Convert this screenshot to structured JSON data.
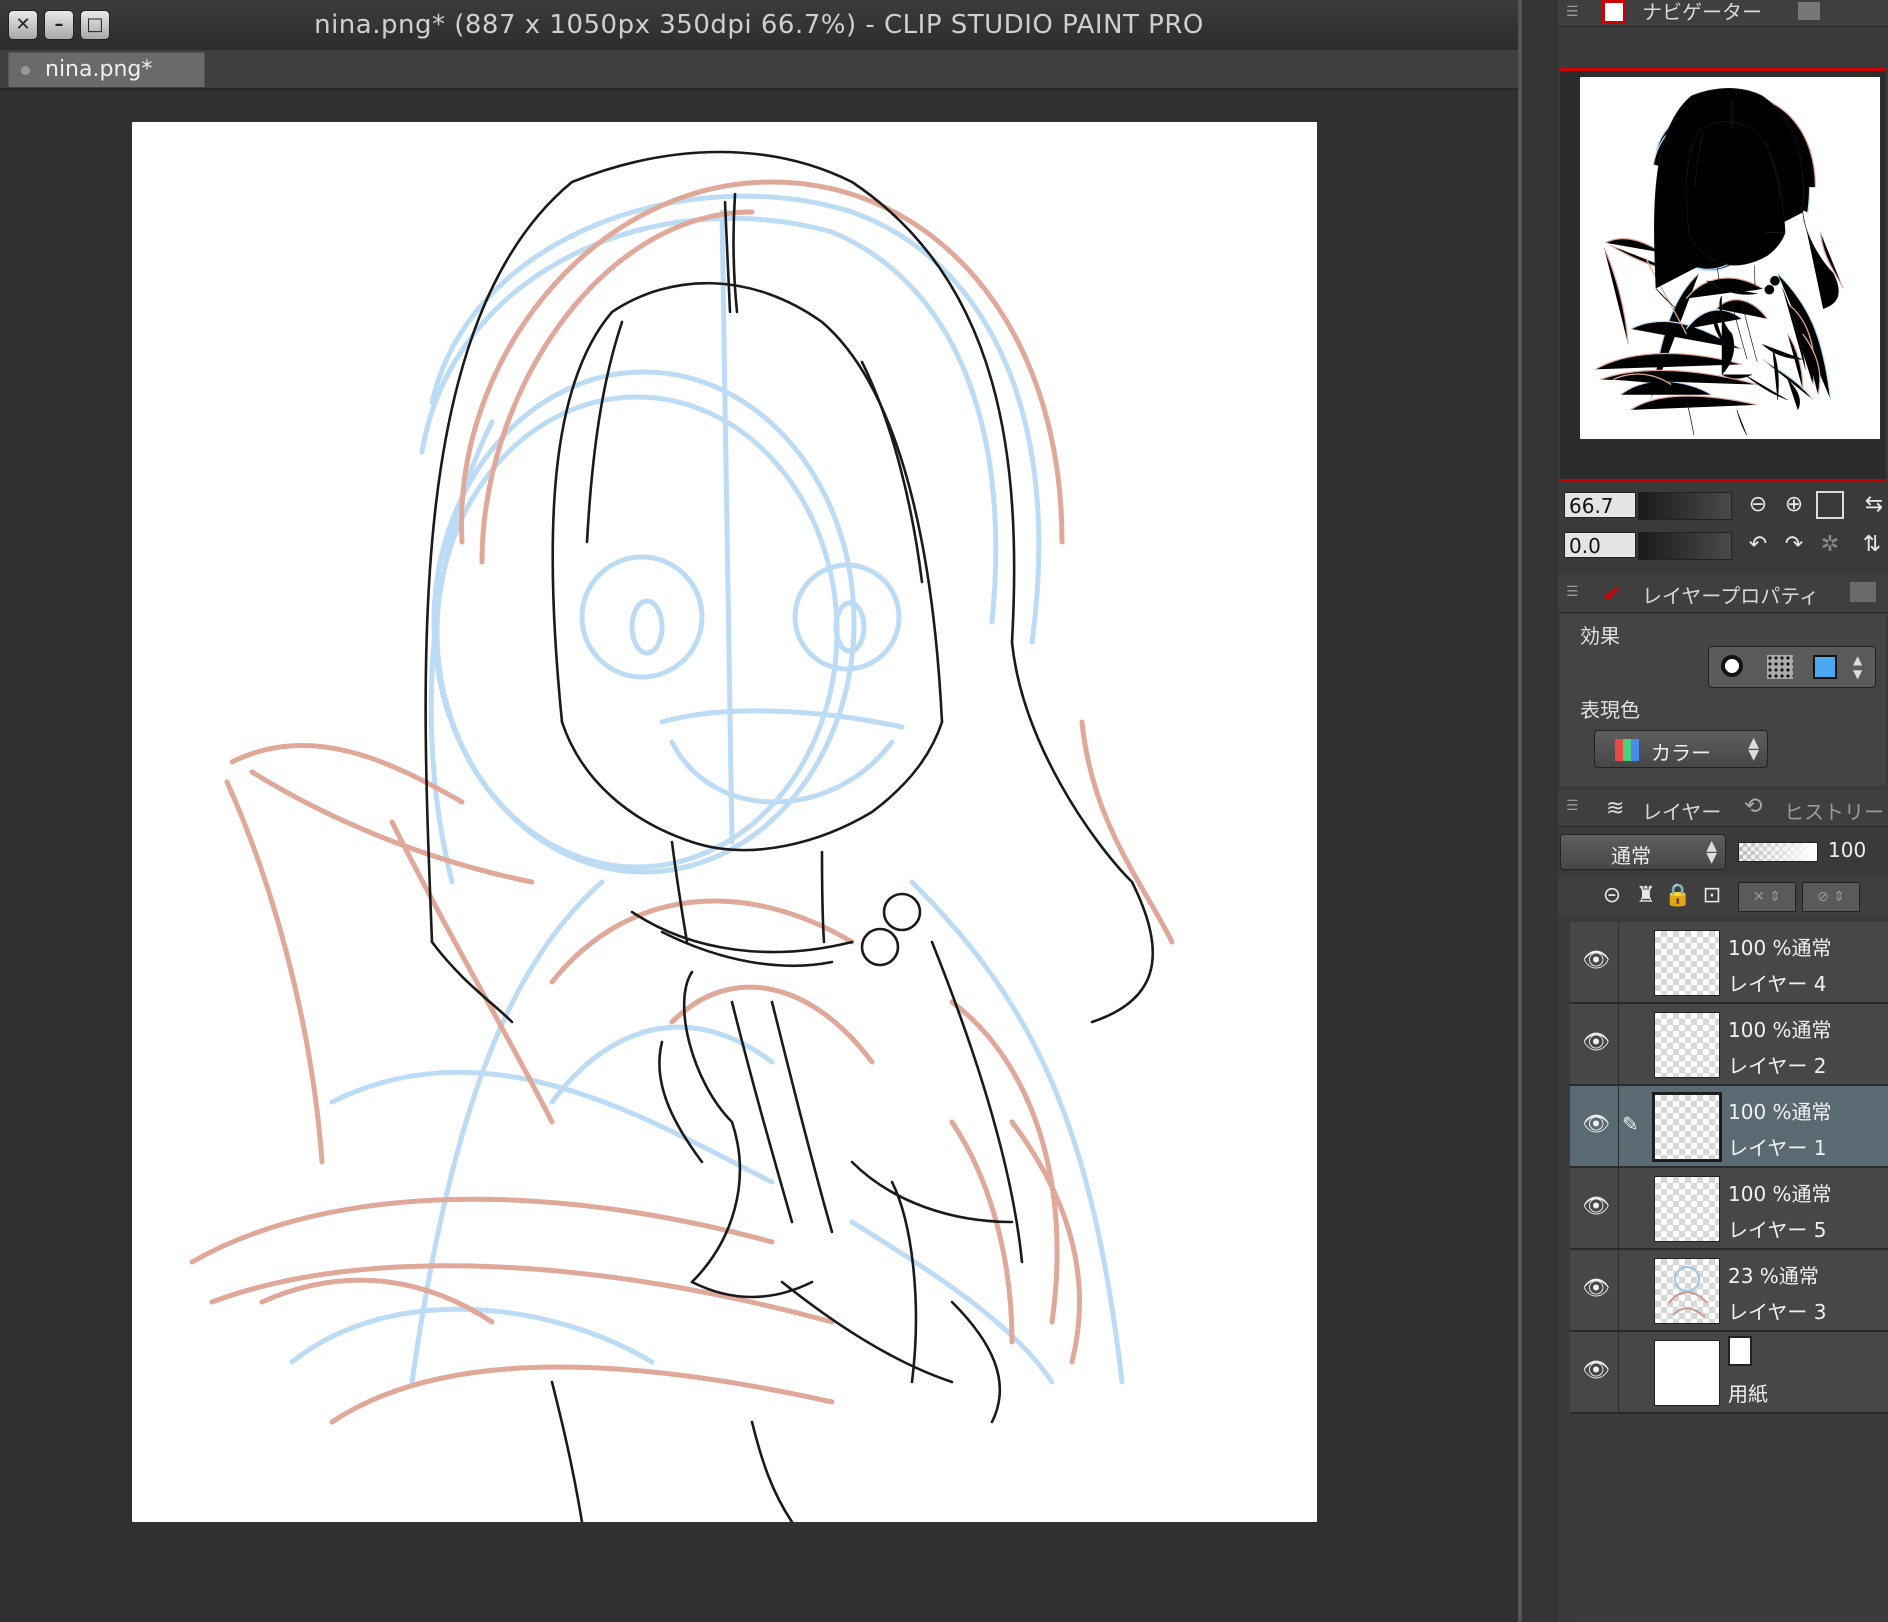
{
  "window": {
    "title": "nina.png* (887 x 1050px 350dpi 66.7%)  - CLIP STUDIO PAINT PRO",
    "tab_label": "nina.png*"
  },
  "navigator": {
    "tab_label": "ナビゲーター",
    "zoom_value": "66.7",
    "rotation_value": "0.0"
  },
  "layer_property": {
    "tab_label": "レイヤープロパティ",
    "effect_label": "効果",
    "expression_label": "表現色",
    "expression_value": "カラー"
  },
  "layers_panel": {
    "tab_label": "レイヤー",
    "history_tab_label": "ヒストリー",
    "blend_mode": "通常",
    "opacity": "100",
    "layers": [
      {
        "mode": "100 %通常",
        "name": "レイヤー 4",
        "selected": false,
        "thumb": "blank"
      },
      {
        "mode": "100 %通常",
        "name": "レイヤー 2",
        "selected": false,
        "thumb": "blank"
      },
      {
        "mode": "100 %通常",
        "name": "レイヤー 1",
        "selected": true,
        "thumb": "blank"
      },
      {
        "mode": "100 %通常",
        "name": "レイヤー 5",
        "selected": false,
        "thumb": "blank"
      },
      {
        "mode": "23 %通常",
        "name": "レイヤー 3",
        "selected": false,
        "thumb": "sketch"
      },
      {
        "mode": "",
        "name": "用紙",
        "selected": false,
        "thumb": "paper"
      }
    ]
  },
  "colors": {
    "sketch_blue": "#bcdcf6",
    "sketch_red": "#e0a898",
    "ink": "#1a1a1a",
    "nav_frame": "#cc0000"
  }
}
